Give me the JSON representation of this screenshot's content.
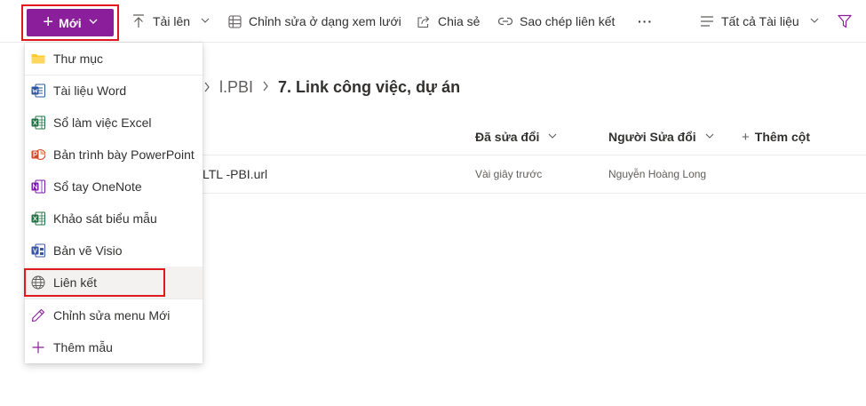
{
  "toolbar": {
    "new_label": "Mới",
    "upload_label": "Tải lên",
    "grid_edit_label": "Chỉnh sửa ở dạng xem lưới",
    "share_label": "Chia sẻ",
    "copy_link_label": "Sao chép liên kết",
    "more_label": "···",
    "view_label": "Tất cả Tài liệu"
  },
  "menu": {
    "items": [
      {
        "label": "Thư mục",
        "icon": "folder-icon"
      },
      {
        "label": "Tài liệu Word",
        "icon": "word-icon"
      },
      {
        "label": "Sổ làm việc Excel",
        "icon": "excel-icon"
      },
      {
        "label": "Bản trình bày PowerPoint",
        "icon": "powerpoint-icon"
      },
      {
        "label": "Sổ tay OneNote",
        "icon": "onenote-icon"
      },
      {
        "label": "Khảo sát biểu mẫu",
        "icon": "forms-excel-icon"
      },
      {
        "label": "Bản vẽ Visio",
        "icon": "visio-icon"
      },
      {
        "label": "Liên kết",
        "icon": "globe-icon"
      },
      {
        "label": "Chỉnh sửa menu Mới",
        "icon": "pencil-icon"
      },
      {
        "label": "Thêm mẫu",
        "icon": "plus-icon"
      }
    ]
  },
  "breadcrumb": {
    "parent": "l.PBI",
    "current": "7. Link công việc, dự án"
  },
  "list": {
    "columns": {
      "modified": "Đã sửa đổi",
      "modified_by": "Người Sửa đổi",
      "add_column": "Thêm cột"
    },
    "rows": [
      {
        "name": "LTL -PBI.url",
        "modified": "Vài giây trước",
        "modified_by": "Nguyễn Hoàng Long"
      }
    ]
  },
  "colors": {
    "accent": "#8a1e9b",
    "highlight_border": "#e0191f"
  }
}
